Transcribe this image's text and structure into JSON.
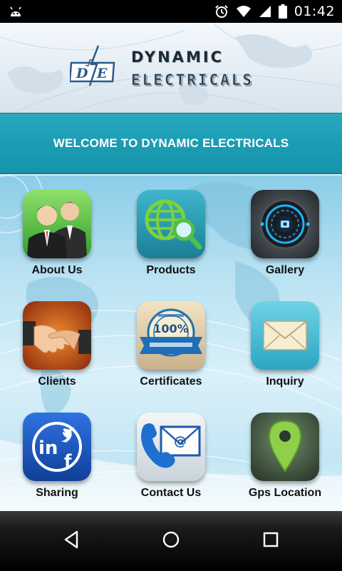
{
  "status_bar": {
    "time": "01:42",
    "icons": [
      "android-debug-icon",
      "alarm-icon",
      "wifi-icon",
      "signal-icon",
      "battery-icon"
    ]
  },
  "header": {
    "logo_mark": "D/E",
    "title_line1": "DYNAMIC",
    "title_line2": "ELECTRICALS"
  },
  "banner": {
    "text": "WELCOME TO DYNAMIC ELECTRICALS",
    "color": "#1b9db4"
  },
  "menu": {
    "items": [
      {
        "label": "About Us",
        "icon": "people-icon"
      },
      {
        "label": "Products",
        "icon": "globe-search-icon"
      },
      {
        "label": "Gallery",
        "icon": "camera-lens-icon"
      },
      {
        "label": "Clients",
        "icon": "handshake-icon"
      },
      {
        "label": "Certificates",
        "icon": "guarantee-seal-icon"
      },
      {
        "label": "Inquiry",
        "icon": "envelope-icon"
      },
      {
        "label": "Sharing",
        "icon": "social-share-icon"
      },
      {
        "label": "Contact Us",
        "icon": "phone-mail-icon"
      },
      {
        "label": "Gps Location",
        "icon": "map-pin-icon"
      }
    ]
  },
  "nav_bar": {
    "buttons": [
      "back-icon",
      "home-icon",
      "recents-icon"
    ]
  }
}
